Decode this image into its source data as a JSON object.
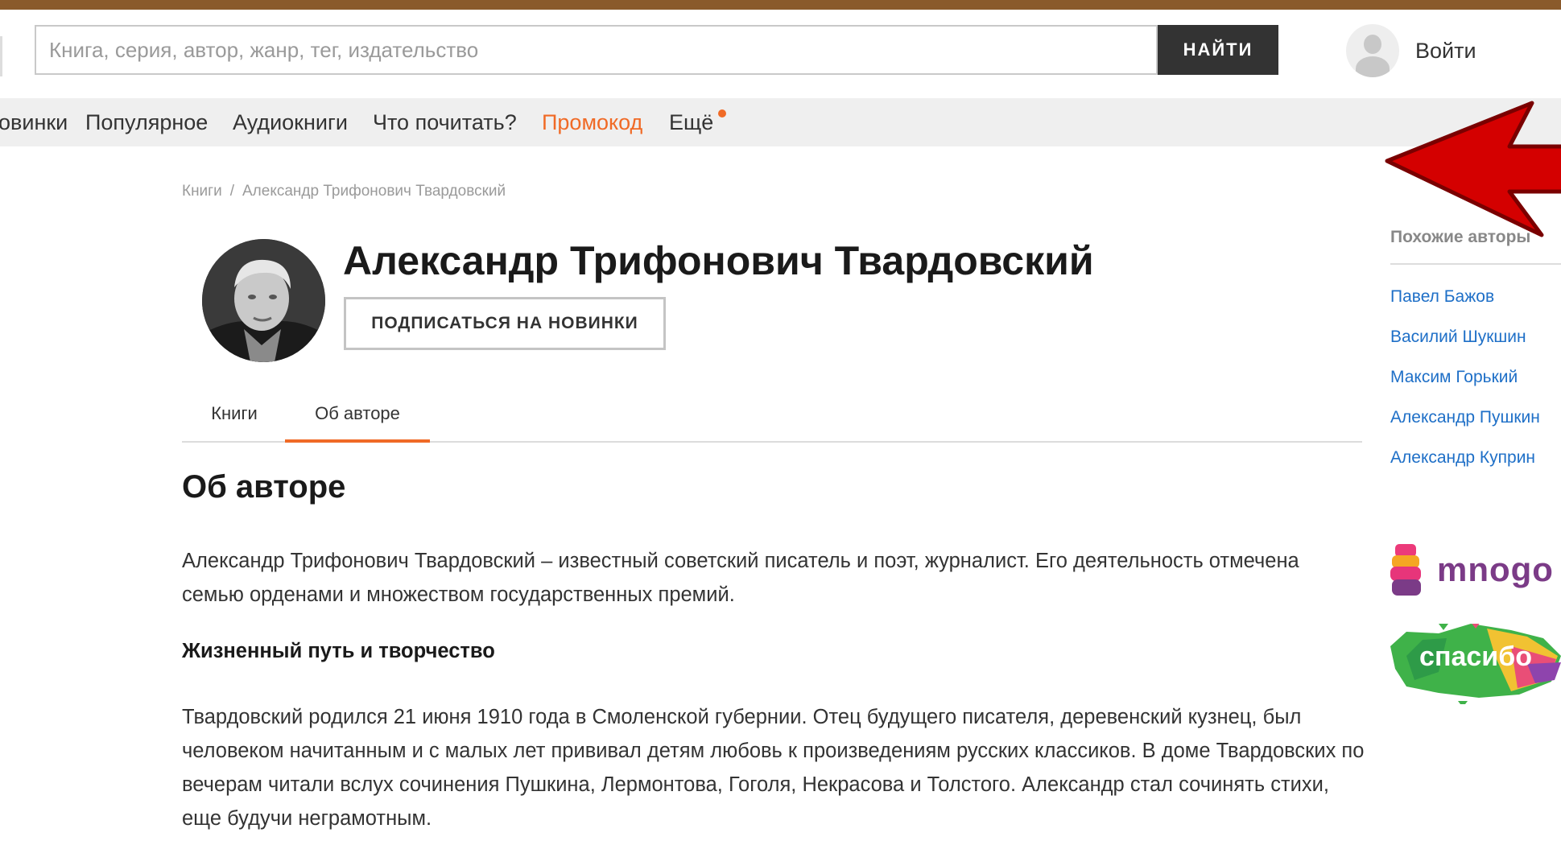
{
  "search": {
    "placeholder": "Книга, серия, автор, жанр, тег, издательство",
    "button_label": "НАЙТИ"
  },
  "login": {
    "label": "Войти"
  },
  "nav": {
    "items": [
      {
        "label": "овинки"
      },
      {
        "label": "Популярное"
      },
      {
        "label": "Аудиокниги"
      },
      {
        "label": "Что почитать?"
      },
      {
        "label": "Промокод"
      },
      {
        "label": "Ещё"
      }
    ],
    "accent_color": "#f06a26"
  },
  "breadcrumb": {
    "items": [
      "Книги",
      "Александр Трифонович Твардовский"
    ],
    "separator": "/"
  },
  "author": {
    "name": "Александр Трифонович Твардовский",
    "subscribe_label": "ПОДПИСАТЬСЯ НА НОВИНКИ"
  },
  "tabs": [
    {
      "label": "Книги"
    },
    {
      "label": "Об авторе",
      "active": true
    }
  ],
  "about": {
    "title": "Об авторе",
    "intro": "Александр Трифонович Твардовский – известный советский писатель и поэт, журналист. Его деятельность отмечена семью орденами и множеством государственных премий.",
    "subheading": "Жизненный путь и творчество",
    "body": "Твардовский родился 21 июня 1910 года в Смоленской губернии. Отец будущего писателя, деревенский кузнец, был человеком начитанным и с малых лет прививал детям любовь к произведениям русских классиков. В доме Твардовских по вечерам читали вслух сочинения Пушкина, Лермонтова, Гоголя, Некрасова и Толстого. Александр стал сочинять стихи, еще будучи неграмотным."
  },
  "similar": {
    "title": "Похожие авторы",
    "authors": [
      "Павел Бажов",
      "Василий Шукшин",
      "Максим Горький",
      "Александр Пушкин",
      "Александр Куприн"
    ]
  },
  "promos": {
    "mnogo": "mnogo",
    "spasibo": "спасибо"
  },
  "colors": {
    "top_stripe": "#8a5a2b",
    "link": "#1e6fc7",
    "annotation_arrow": "#d40000"
  }
}
